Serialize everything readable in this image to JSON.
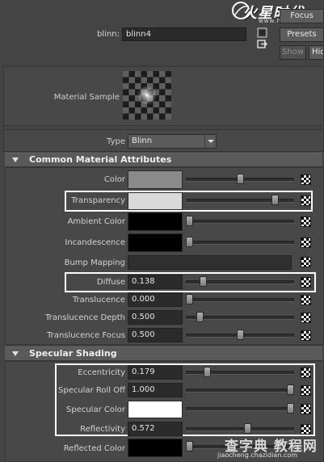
{
  "header": {
    "node_label": "blinn:",
    "node_name": "blinn4",
    "buttons": {
      "focus": "Focus",
      "presets": "Presets",
      "show": "Show",
      "hide": "Hide"
    },
    "logo": {
      "text": "火星时代",
      "url": "www.hxsd.com"
    }
  },
  "sample": {
    "label": "Material Sample"
  },
  "type": {
    "label": "Type",
    "value": "Blinn"
  },
  "sections": {
    "common": "Common Material Attributes",
    "specular": "Specular Shading"
  },
  "attributes": {
    "color": {
      "label": "Color",
      "swatch": "#8a8a8a",
      "slider": 0.5
    },
    "transparency": {
      "label": "Transparency",
      "swatch": "#d9d9d9",
      "slider": 0.85
    },
    "ambient": {
      "label": "Ambient Color",
      "swatch": "#000000",
      "slider": 0.0
    },
    "incandescence": {
      "label": "Incandescence",
      "swatch": "#000000",
      "slider": 0.0
    },
    "bump": {
      "label": "Bump Mapping"
    },
    "diffuse": {
      "label": "Diffuse",
      "value": "0.138",
      "slider": 0.138
    },
    "translucence": {
      "label": "Translucence",
      "value": "0.000",
      "slider": 0.0
    },
    "translucence_depth": {
      "label": "Translucence Depth",
      "value": "0.500",
      "slider": 0.1
    },
    "translucence_focus": {
      "label": "Translucence Focus",
      "value": "0.500",
      "slider": 0.5
    },
    "eccentricity": {
      "label": "Eccentricity",
      "value": "0.179",
      "slider": 0.179
    },
    "spec_rolloff": {
      "label": "Specular Roll Off",
      "value": "1.000",
      "slider": 1.0
    },
    "spec_color": {
      "label": "Specular Color",
      "swatch": "#ffffff",
      "slider": 1.0
    },
    "reflectivity": {
      "label": "Reflectivity",
      "value": "0.572",
      "slider": 0.572
    },
    "reflected_color": {
      "label": "Reflected Color",
      "swatch": "#000000",
      "slider": 0.0
    }
  },
  "watermark": {
    "text": "查字典 教程网",
    "url": "jiaocheng.chazidian.com"
  }
}
